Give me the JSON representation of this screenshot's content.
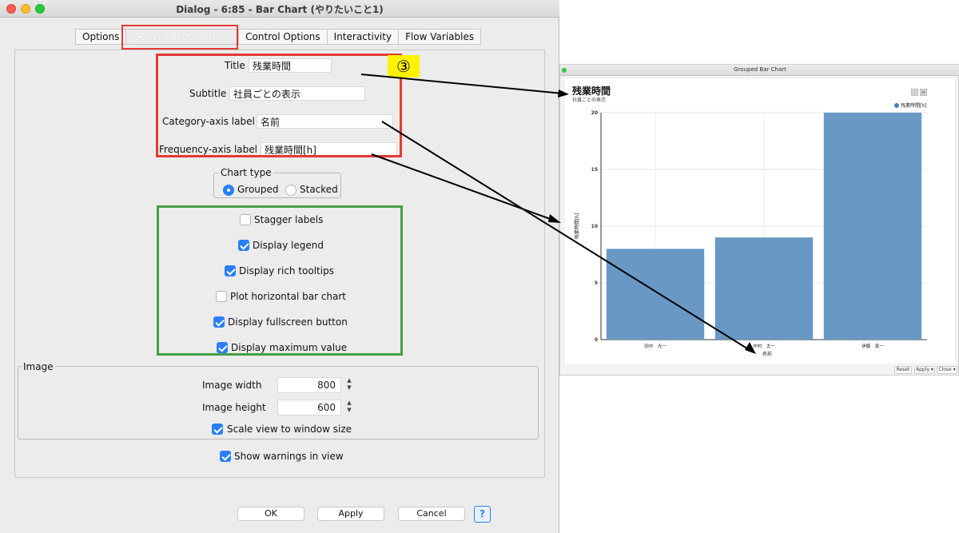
{
  "dialog": {
    "title": "Dialog - 6:85 - Bar Chart (やりたいこと1)",
    "tabs": [
      "Options",
      "General Plot Options",
      "Control Options",
      "Interactivity",
      "Flow Variables"
    ],
    "selected_tab": "General Plot Options"
  },
  "labels": {
    "title_label": "Title",
    "title_value": "残業時間",
    "subtitle_label": "Subtitle",
    "subtitle_value": "社員ごとの表示",
    "category_label": "Category-axis label",
    "category_value": "名前",
    "frequency_label": "Frequency-axis label",
    "frequency_value": "残業時間[h]"
  },
  "annotation_badge": "③",
  "chart_type": {
    "legend": "Chart type",
    "options": [
      "Grouped",
      "Stacked"
    ],
    "selected": "Grouped"
  },
  "display_options": [
    {
      "label": "Stagger labels",
      "checked": false
    },
    {
      "label": "Display legend",
      "checked": true
    },
    {
      "label": "Display rich tooltips",
      "checked": true
    },
    {
      "label": "Plot horizontal bar chart",
      "checked": false
    },
    {
      "label": "Display fullscreen button",
      "checked": true
    },
    {
      "label": "Display maximum value",
      "checked": true
    }
  ],
  "image": {
    "legend": "Image",
    "width_label": "Image width",
    "width_value": "800",
    "height_label": "Image height",
    "height_value": "600",
    "scale_label": "Scale view to window size",
    "scale_checked": true
  },
  "warnings": {
    "label": "Show warnings in view",
    "checked": true
  },
  "buttons": {
    "ok": "OK",
    "apply": "Apply",
    "cancel": "Cancel",
    "help": "?"
  },
  "chart_window": {
    "title": "Grouped Bar Chart",
    "footer_reset": "Reset",
    "footer_apply": "Apply ▾",
    "footer_close": "Close ▾"
  },
  "colors": {
    "bar": "#6998c5",
    "red_annotation": "#e53935",
    "green_annotation": "#43a047",
    "badge": "#fff200",
    "accent": "#2a7ff6"
  },
  "chart_data": {
    "type": "bar",
    "title": "残業時間",
    "subtitle": "社員ごとの表示",
    "xlabel": "名前",
    "ylabel": "残業時間[h]",
    "categories": [
      "田中　光一",
      "中村　太一",
      "伊藤　真一"
    ],
    "series": [
      {
        "name": "残業時間[h]",
        "values": [
          8,
          9,
          20
        ]
      }
    ],
    "ylim": [
      0,
      20
    ],
    "yticks": [
      0,
      5,
      10,
      15,
      20
    ],
    "grid": true,
    "legend": "top-right"
  }
}
